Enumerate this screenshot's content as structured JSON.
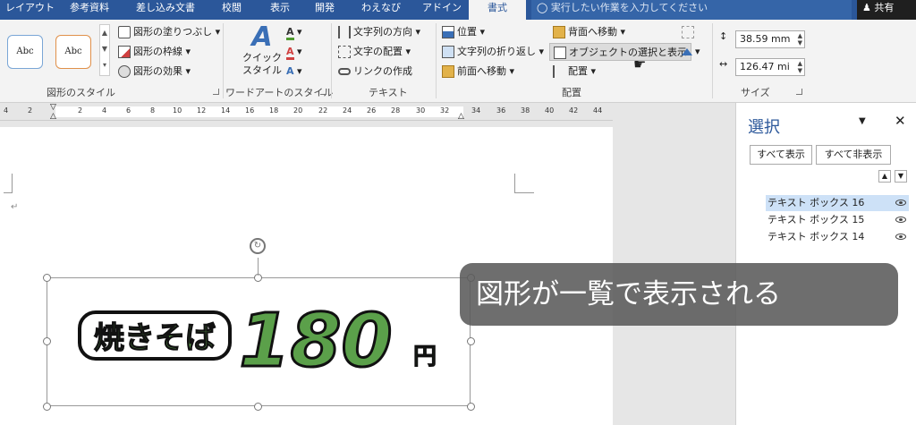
{
  "tabs": [
    "レイアウト",
    "参考資料",
    "差し込み文書",
    "校閲",
    "表示",
    "開発",
    "わえなび",
    "アドイン",
    "書式"
  ],
  "tell_me": "実行したい作業を入力してください",
  "share": "共有",
  "ribbon": {
    "shape_style_samples": [
      "Abc",
      "Abc"
    ],
    "shape_fill": "図形の塗りつぶし",
    "shape_outline": "図形の枠線",
    "shape_effects": "図形の効果",
    "group_shape_styles": "図形のスタイル",
    "quick_styles_1": "クイック",
    "quick_styles_2": "スタイル",
    "group_wordart": "ワードアートのスタイル",
    "text_direction": "文字列の方向",
    "align_text": "文字の配置",
    "create_link": "リンクの作成",
    "group_text": "テキスト",
    "position": "位置",
    "wrap_text": "文字列の折り返し",
    "bring_forward": "前面へ移動",
    "send_backward": "背面へ移動",
    "selection_pane": "オブジェクトの選択と表示",
    "align": "配置",
    "group_arrange": "配置",
    "height": "38.59 mm",
    "width": "126.47 mi",
    "group_size": "サイズ"
  },
  "ruler_ticks": [
    "4",
    "2",
    "2",
    "4",
    "6",
    "8",
    "10",
    "12",
    "14",
    "16",
    "18",
    "20",
    "22",
    "24",
    "26",
    "28",
    "30",
    "32",
    "34",
    "36",
    "38",
    "40",
    "42",
    "44"
  ],
  "pane": {
    "title": "選択",
    "show_all": "すべて表示",
    "hide_all": "すべて非表示",
    "items": [
      "テキスト ボックス 16",
      "テキスト ボックス 15",
      "テキスト ボックス 14"
    ]
  },
  "doc": {
    "title_text": "焼きそば",
    "price": "180",
    "yen": "円"
  },
  "caption": "図形が一覧で表示される"
}
